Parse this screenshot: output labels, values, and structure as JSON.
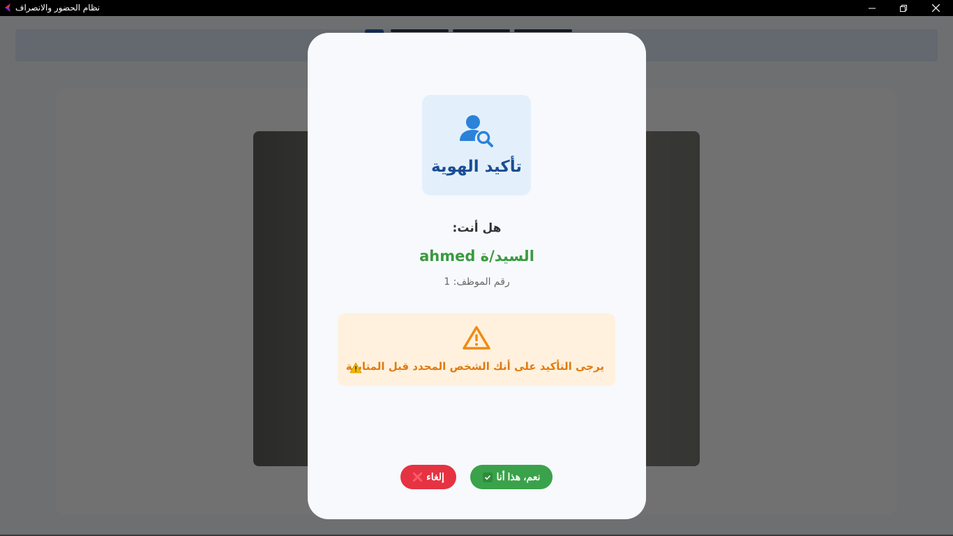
{
  "window": {
    "title": "نظام الحضور والانصراف"
  },
  "dialog": {
    "header_title": "تأكيد الهوية",
    "question": "هل أنت:",
    "person_name": "السيد/ة ahmed",
    "employee_id": "رقم الموظف: 1",
    "warning_text": "يرجى التأكيد على أنك الشخص المحدد قبل المتابعة",
    "confirm_label": "نعم، هذا أنا",
    "cancel_label": "إلغاء"
  },
  "colors": {
    "accent_blue": "#1a4d94",
    "success_green": "#3aa24a",
    "danger_red": "#e53342",
    "warning_orange": "#e07a10"
  },
  "icons": {
    "header": "user-search-icon",
    "warning": "warning-triangle-icon",
    "confirm": "check-icon",
    "cancel": "x-icon"
  }
}
